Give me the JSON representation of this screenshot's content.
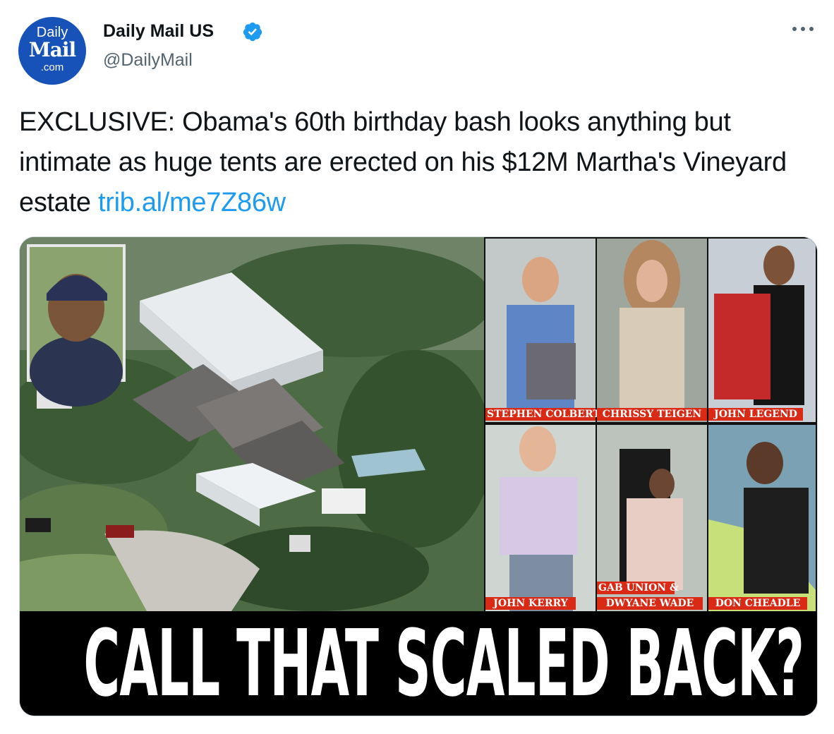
{
  "account": {
    "avatar_line1": "Daily",
    "avatar_line2": "Mail",
    "avatar_line3": ".com",
    "display_name": "Daily Mail US",
    "handle": "@DailyMail",
    "verified": true
  },
  "tweet": {
    "text": "EXCLUSIVE: Obama's 60th birthday bash looks anything but intimate as huge tents are erected on his $12M Martha's Vineyard estate ",
    "link": "trib.al/me7Z86w"
  },
  "media": {
    "captions": {
      "colbert": "STEPHEN COLBERT",
      "teigen": "CHRISSY TEIGEN",
      "legend": "JOHN LEGEND",
      "kerry": "JOHN KERRY",
      "union_line1": "GAB UNION &",
      "union_line2": "DWYANE WADE",
      "cheadle": "DON CHEADLE"
    },
    "headline": "CALL THAT SCALED BACK?"
  },
  "colors": {
    "link": "#1d9bf0",
    "verified": "#1d9bf0",
    "avatar_bg": "#1652b8",
    "caption_bg": "#d92a16"
  },
  "icons": [
    "verified-badge-icon",
    "more-options-icon"
  ]
}
